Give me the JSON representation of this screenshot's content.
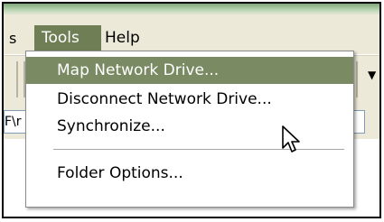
{
  "menubar": {
    "left_fragment": "s",
    "tools": "Tools",
    "help": "Help"
  },
  "address": {
    "text": "F\\r"
  },
  "tools_menu": {
    "items": [
      {
        "label": "Map Network Drive..."
      },
      {
        "label": "Disconnect Network Drive..."
      },
      {
        "label": "Synchronize..."
      },
      {
        "label": "Folder Options..."
      }
    ]
  },
  "colors": {
    "menu_highlight": "#7a8a63",
    "menubar_bg": "#ece9d8"
  }
}
